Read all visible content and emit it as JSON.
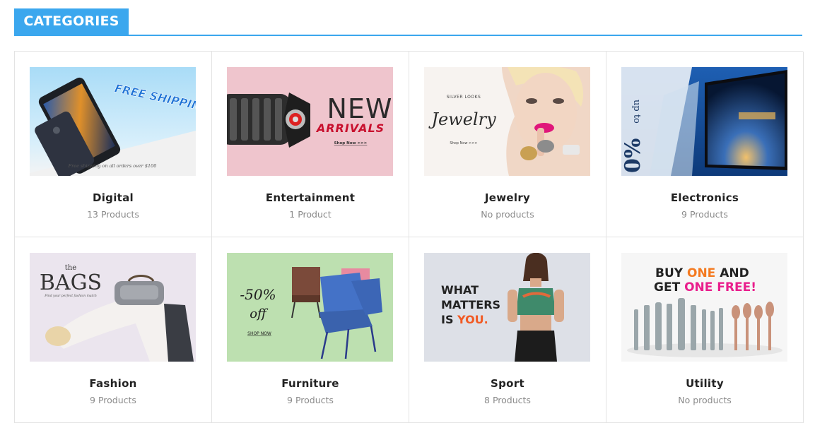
{
  "section": {
    "title": "CATEGORIES"
  },
  "categories": [
    {
      "name": "Digital",
      "count": "13 Products",
      "banner": {
        "headline": "FREE SHIPPING!",
        "caption": "Free shipping on all orders over $100"
      }
    },
    {
      "name": "Entertainment",
      "count": "1 Product",
      "banner": {
        "headline": "NEW",
        "subheadline": "ARRIVALS",
        "cta": "Shop Now >>>"
      }
    },
    {
      "name": "Jewelry",
      "count": "No products",
      "banner": {
        "kicker": "SILVER LOOKS",
        "headline": "Jewelry",
        "cta": "Shop Now >>>"
      }
    },
    {
      "name": "Electronics",
      "count": "9 Products",
      "banner": {
        "kicker": "up to",
        "headline": "0%"
      }
    },
    {
      "name": "Fashion",
      "count": "9 Products",
      "banner": {
        "kicker": "the",
        "headline": "BAGS",
        "caption": "Find your perfect fashion match"
      }
    },
    {
      "name": "Furniture",
      "count": "9 Products",
      "banner": {
        "headline": "-50%",
        "subheadline": "off",
        "cta": "SHOP NOW"
      }
    },
    {
      "name": "Sport",
      "count": "8 Products",
      "banner": {
        "line1": "WHAT",
        "line2": "MATTERS",
        "line3_prefix": "IS ",
        "line3_accent": "YOU."
      }
    },
    {
      "name": "Utility",
      "count": "No products",
      "banner": {
        "line1_a": "BUY ",
        "line1_b": "ONE",
        "line1_c": " AND",
        "line2_a": "GET ",
        "line2_b": "ONE FREE!"
      }
    }
  ],
  "colors": {
    "accent": "#3ba7ee",
    "red": "#c8102e",
    "orange": "#f15a24",
    "pink": "#e91e8c"
  }
}
